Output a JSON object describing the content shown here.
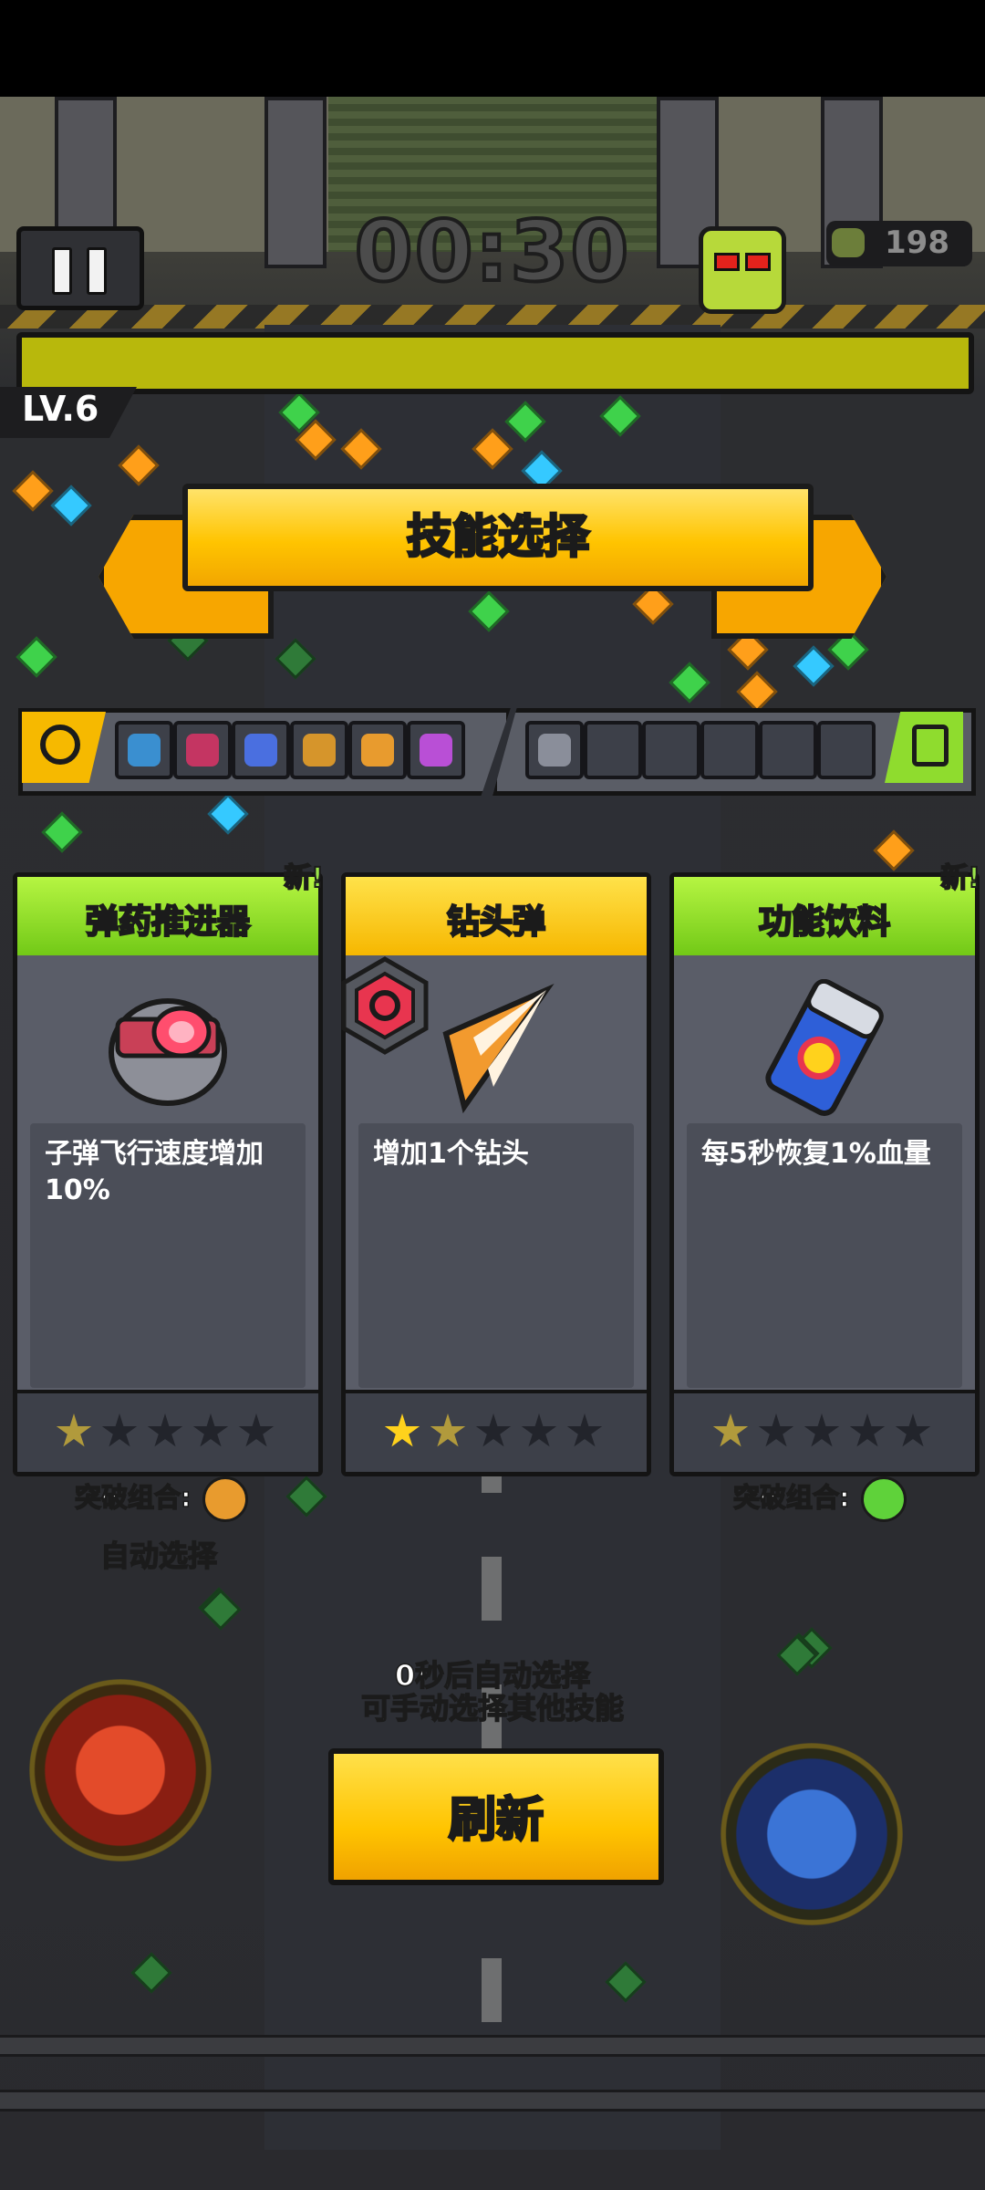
{
  "hud": {
    "timer": "00:30",
    "kill_count": "198",
    "level": "LV.6",
    "xp_fraction": 1.0
  },
  "banner": {
    "title": "技能选择"
  },
  "skill_slots": {
    "active": [
      "wand-icon",
      "dragon-icon",
      "crystal-icon",
      "pot-icon",
      "drill-icon",
      "cone-icon"
    ],
    "passive": [
      "boot-icon",
      "",
      "",
      "",
      "",
      ""
    ]
  },
  "cards": [
    {
      "name": "弹药推进器",
      "new_tag": "新!",
      "header_color": "#8fe22e",
      "icon": "thruster-icon",
      "description": "子弹飞行速度增加10%",
      "stars_filled": 1,
      "stars_total": 5,
      "combo_label": "突破组合:",
      "combo_icon": "drill-icon"
    },
    {
      "name": "钻头弹",
      "new_tag": "",
      "header_color": "#ffcf1f",
      "icon": "drill-icon",
      "description": "增加1个钻头",
      "stars_filled": 2,
      "stars_total": 5,
      "combo_label": "",
      "combo_icon": ""
    },
    {
      "name": "功能饮料",
      "new_tag": "新!",
      "header_color": "#8fe22e",
      "icon": "energy-drink-icon",
      "description": "每5秒恢复1%血量",
      "stars_filled": 1,
      "stars_total": 5,
      "combo_label": "突破组合:",
      "combo_icon": "green-orb-icon"
    }
  ],
  "auto_select_label": "自动选择",
  "notice_line1": "0秒后自动选择",
  "notice_line2": "可手动选择其他技能",
  "refresh_label": "刷新",
  "colors": {
    "accent_yellow": "#ffc400",
    "accent_green": "#8fe22e",
    "xp_bar": "#b8b80c"
  }
}
